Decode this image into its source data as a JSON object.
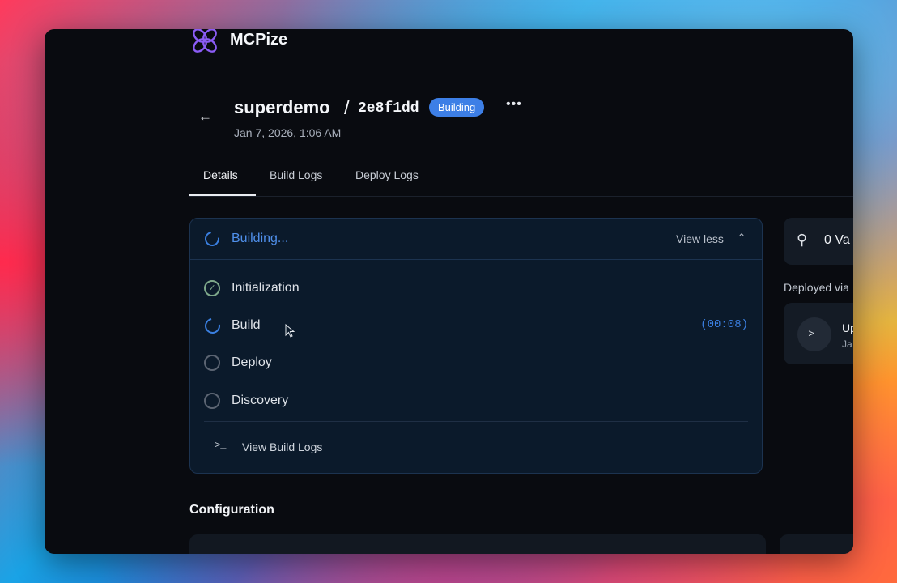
{
  "app": {
    "name": "MCPize",
    "logo_icon": "mcpize-logo-icon"
  },
  "header": {
    "project": "superdemo",
    "separator": "/",
    "commit": "2e8f1dd",
    "status_badge": "Building",
    "more_icon": "ellipsis-icon",
    "date": "Jan 7, 2026, 1:06 AM"
  },
  "tabs": [
    {
      "label": "Details",
      "active": true
    },
    {
      "label": "Build Logs",
      "active": false
    },
    {
      "label": "Deploy Logs",
      "active": false
    }
  ],
  "build_card": {
    "status": "Building...",
    "toggle": "View less",
    "steps": [
      {
        "label": "Initialization",
        "state": "done"
      },
      {
        "label": "Build",
        "state": "running",
        "timer": "(00:08)"
      },
      {
        "label": "Deploy",
        "state": "pending"
      },
      {
        "label": "Discovery",
        "state": "pending"
      }
    ],
    "logs_link": "View Build Logs"
  },
  "side": {
    "vars": "0 Va",
    "deployed_via": "Deployed via",
    "deploy_title": "Up",
    "deploy_sub": "Ja"
  },
  "configuration": {
    "title": "Configuration"
  },
  "colors": {
    "accent": "#3d7fe6",
    "background": "#090b10",
    "card": "#0b1a2b",
    "success": "#7ea88a"
  }
}
